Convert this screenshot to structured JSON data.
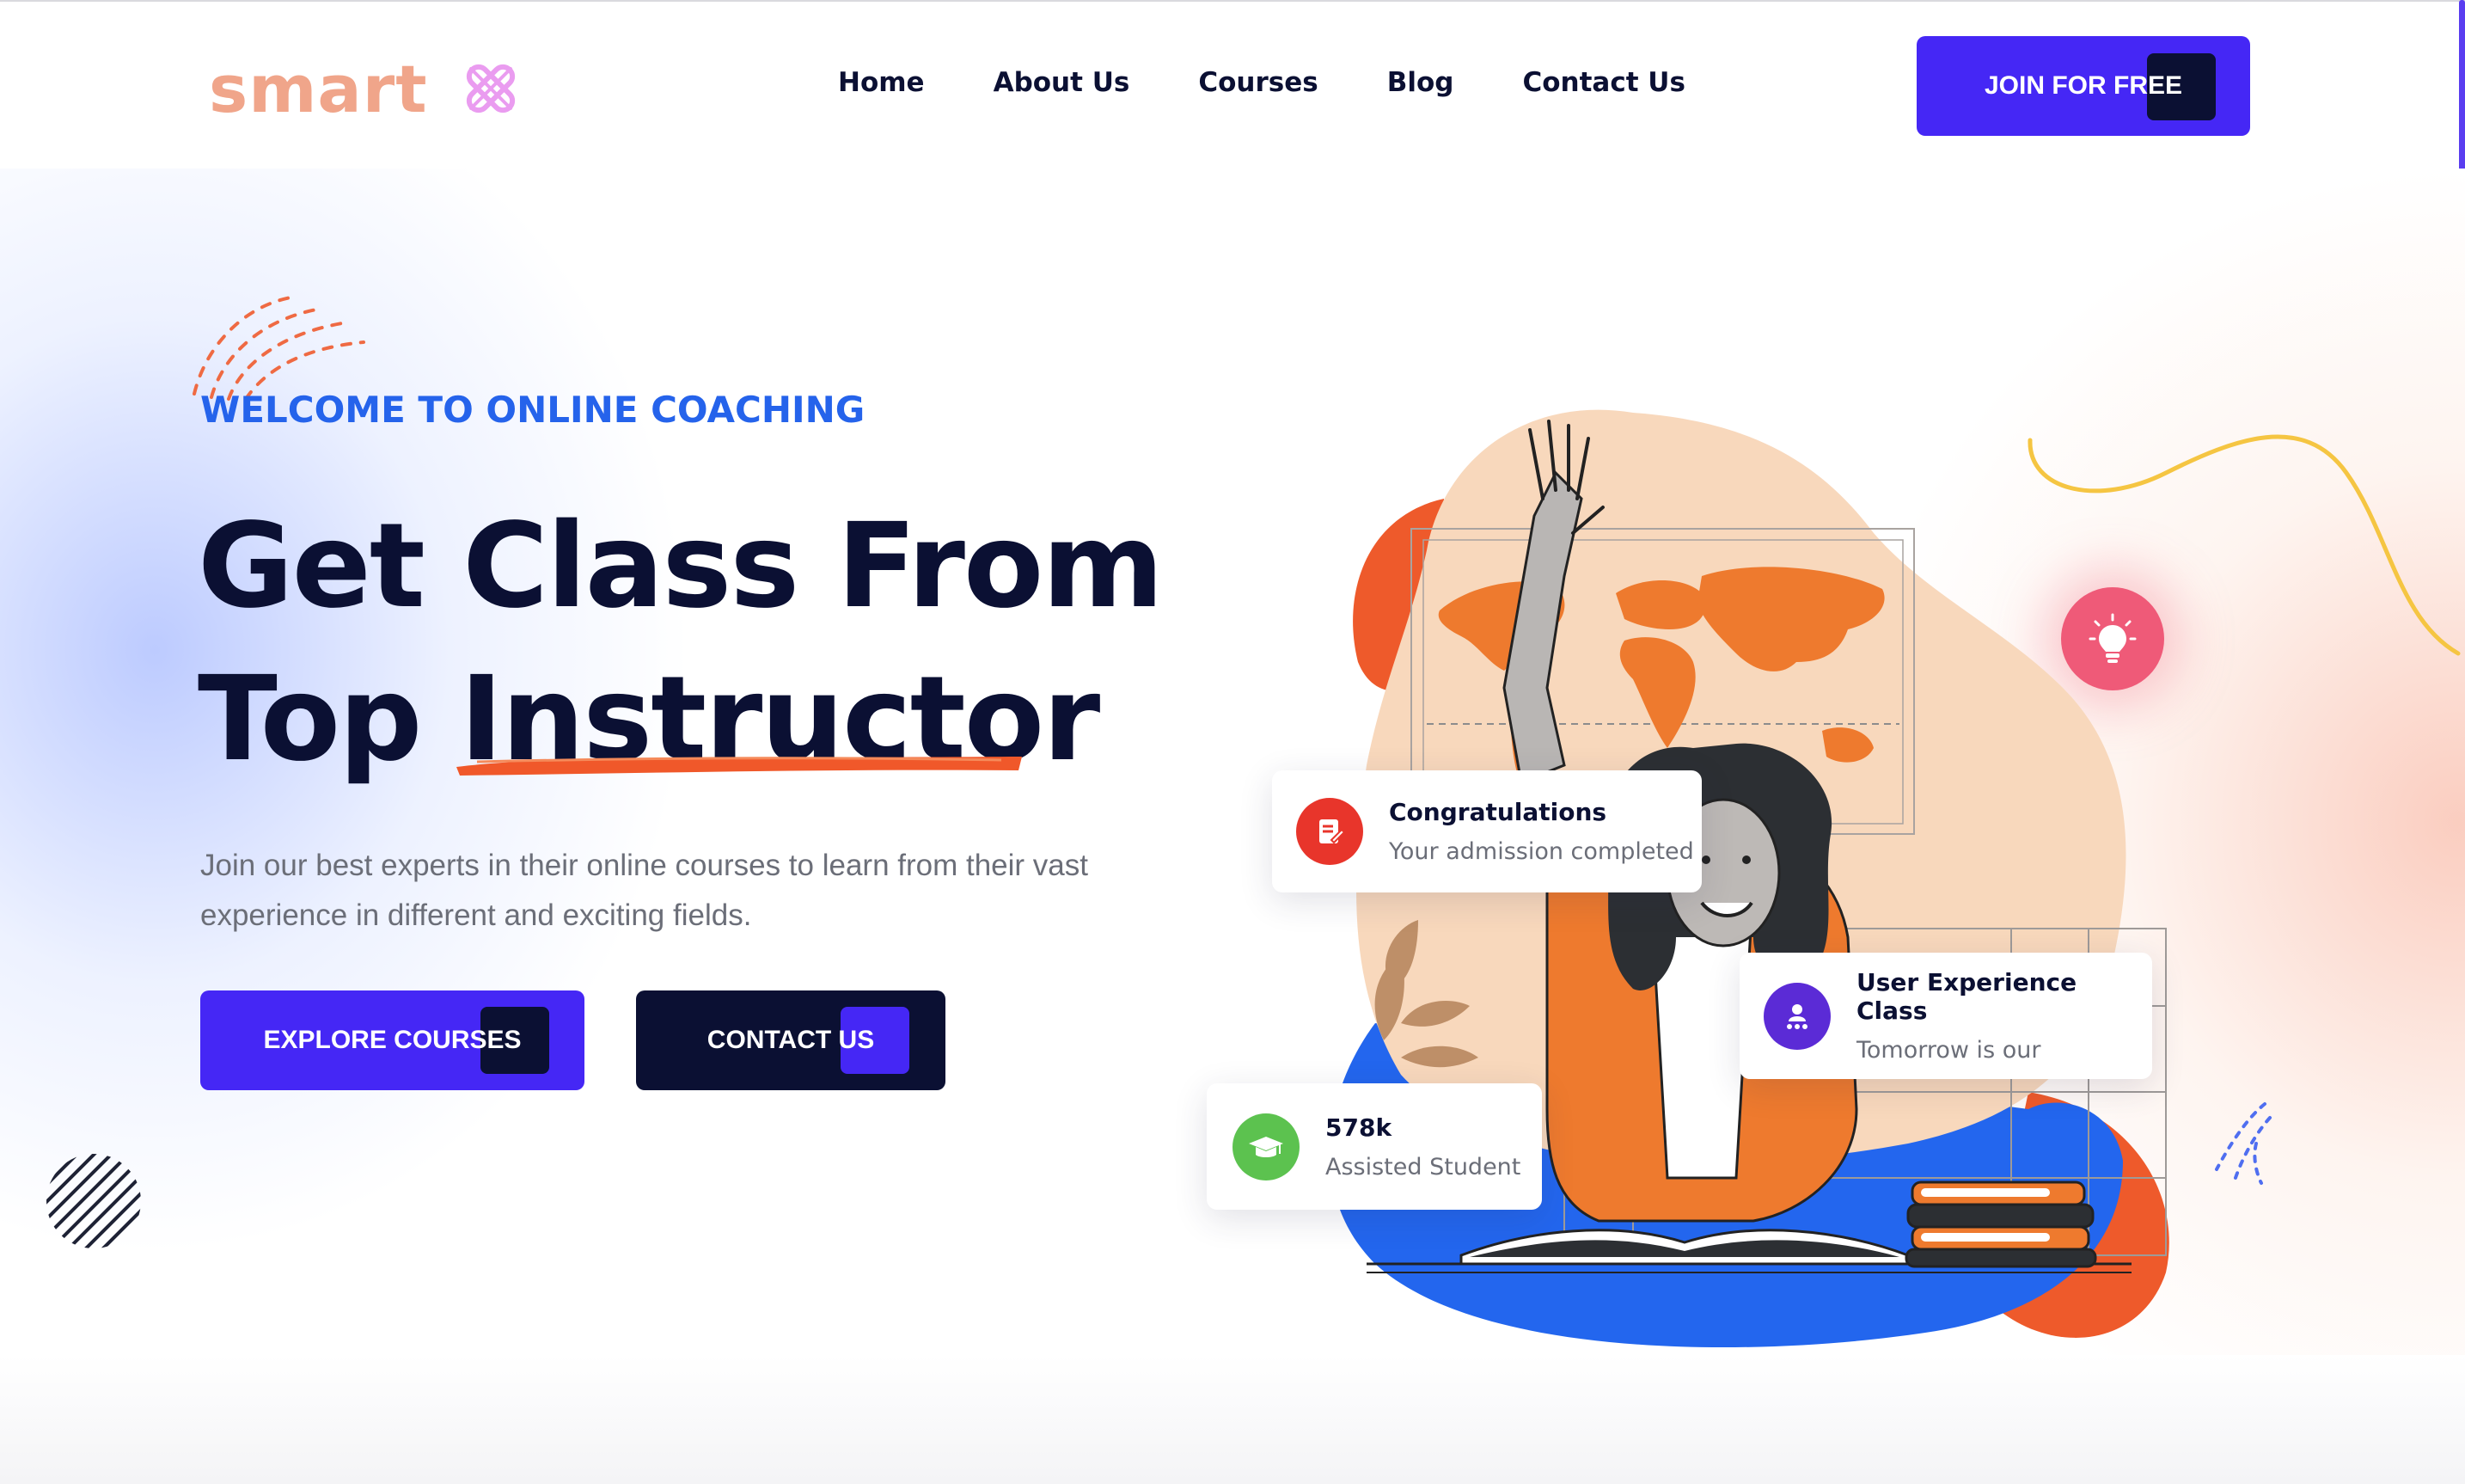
{
  "header": {
    "logo_text": "smart",
    "nav": [
      "Home",
      "About Us",
      "Courses",
      "Blog",
      "Contact Us"
    ],
    "cta_label": "JOIN FOR FREE"
  },
  "hero": {
    "kicker": "WELCOME TO ONLINE COACHING",
    "title_line1": "Get Class From",
    "title_line2": "Top Instructor",
    "description": "Join our best experts in their online courses to learn from their vast experience in different and exciting fields.",
    "primary_button": "EXPLORE COURSES",
    "secondary_button": "CONTACT US"
  },
  "cards": {
    "congrats": {
      "title": "Congratulations",
      "subtitle": "Your admission completed",
      "icon": "document-edit-icon",
      "color": "#e8352b"
    },
    "ux_class": {
      "title": "User Experience Class",
      "subtitle": "Tomorrow is our",
      "icon": "user-group-icon",
      "color": "#5b2bd6"
    },
    "students": {
      "title": "578k",
      "subtitle": "Assisted Student",
      "icon": "graduation-cap-icon",
      "color": "#5cc24f"
    }
  },
  "colors": {
    "primary": "#4527f5",
    "dark": "#0b1033",
    "accent_blue": "#2563eb",
    "accent_orange": "#f06a2e",
    "logo": "#f0a58a"
  }
}
